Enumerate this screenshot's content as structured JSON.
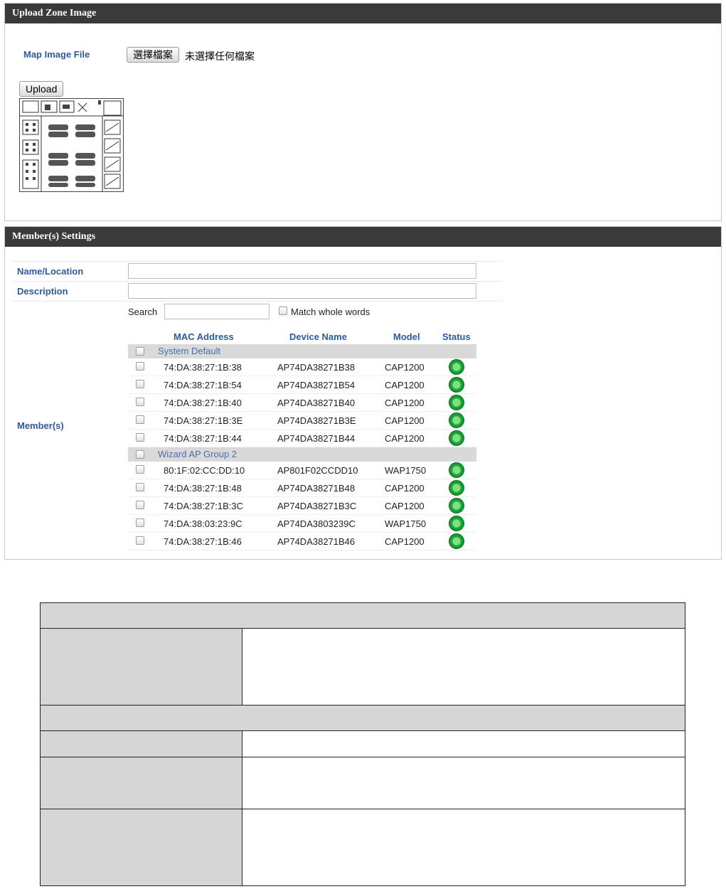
{
  "upload_panel": {
    "title": "Upload Zone Image",
    "map_label": "Map Image File",
    "choose_button": "選擇檔案",
    "file_status": "未選擇任何檔案",
    "upload_button": "Upload"
  },
  "members_panel": {
    "title": "Member(s) Settings",
    "name_label": "Name/Location",
    "name_value": "",
    "description_label": "Description",
    "description_value": "",
    "members_label": "Member(s)",
    "search_label": "Search",
    "search_value": "",
    "match_whole_words": "Match whole words",
    "table": {
      "headers": [
        "MAC Address",
        "Device Name",
        "Model",
        "Status"
      ],
      "groups": [
        {
          "name": "System Default",
          "rows": [
            {
              "mac": "74:DA:38:27:1B:38",
              "device": "AP74DA38271B38",
              "model": "CAP1200",
              "status": "online"
            },
            {
              "mac": "74:DA:38:27:1B:54",
              "device": "AP74DA38271B54",
              "model": "CAP1200",
              "status": "online"
            },
            {
              "mac": "74:DA:38:27:1B:40",
              "device": "AP74DA38271B40",
              "model": "CAP1200",
              "status": "online"
            },
            {
              "mac": "74:DA:38:27:1B:3E",
              "device": "AP74DA38271B3E",
              "model": "CAP1200",
              "status": "online"
            },
            {
              "mac": "74:DA:38:27:1B:44",
              "device": "AP74DA38271B44",
              "model": "CAP1200",
              "status": "online"
            }
          ]
        },
        {
          "name": "Wizard AP Group 2",
          "rows": [
            {
              "mac": "80:1F:02:CC:DD:10",
              "device": "AP801F02CCDD10",
              "model": "WAP1750",
              "status": "online"
            },
            {
              "mac": "74:DA:38:27:1B:48",
              "device": "AP74DA38271B48",
              "model": "CAP1200",
              "status": "online"
            },
            {
              "mac": "74:DA:38:27:1B:3C",
              "device": "AP74DA38271B3C",
              "model": "CAP1200",
              "status": "online"
            },
            {
              "mac": "74:DA:38:03:23:9C",
              "device": "AP74DA3803239C",
              "model": "WAP1750",
              "status": "online"
            },
            {
              "mac": "74:DA:38:27:1B:46",
              "device": "AP74DA38271B46",
              "model": "CAP1200",
              "status": "online"
            }
          ]
        }
      ]
    }
  },
  "colors": {
    "header_bg": "#3a3a3a",
    "label_blue": "#2c5aa0",
    "status_green": "#1ea83c",
    "group_row_bg": "#d9d9d9",
    "table_cell_gray": "#d6d6d6"
  }
}
